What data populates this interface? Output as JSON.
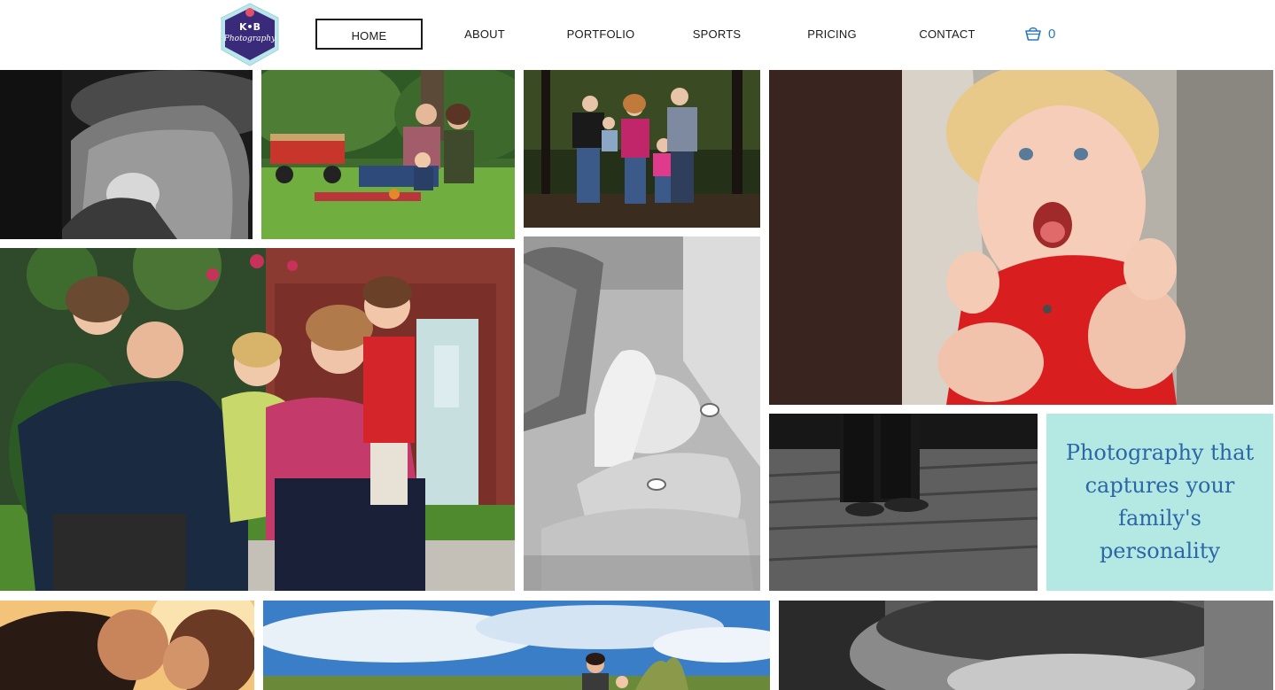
{
  "header": {
    "logo": {
      "text_line1": "K•B",
      "text_line2": "Photography",
      "colors": {
        "badge": "#3a2a7a",
        "outline": "#b8e6ea",
        "accent": "#e24f6a"
      }
    },
    "nav": [
      {
        "label": "HOME",
        "active": true
      },
      {
        "label": "ABOUT",
        "active": false
      },
      {
        "label": "PORTFOLIO",
        "active": false
      },
      {
        "label": "SPORTS",
        "active": false
      },
      {
        "label": "PRICING",
        "active": false
      },
      {
        "label": "CONTACT",
        "active": false
      }
    ],
    "cart": {
      "icon": "shopping-basket-icon",
      "count": "0",
      "color": "#2a78c0"
    }
  },
  "gallery": {
    "tagline": "Photography that captures your family's personality",
    "tagline_bg": "#b3e8e3",
    "tagline_color": "#2b66a6",
    "photos": [
      {
        "subject": "toddler-armchair-bw"
      },
      {
        "subject": "family-wagon-lawn"
      },
      {
        "subject": "family-forest"
      },
      {
        "subject": "baby-red-shirt"
      },
      {
        "subject": "grandparents-kids"
      },
      {
        "subject": "hands-rings-bw"
      },
      {
        "subject": "toddler-feet-dock-bw"
      },
      {
        "subject": "couple-sunset-kiss"
      },
      {
        "subject": "family-beach-sky"
      },
      {
        "subject": "child-closeup-bw"
      }
    ]
  }
}
